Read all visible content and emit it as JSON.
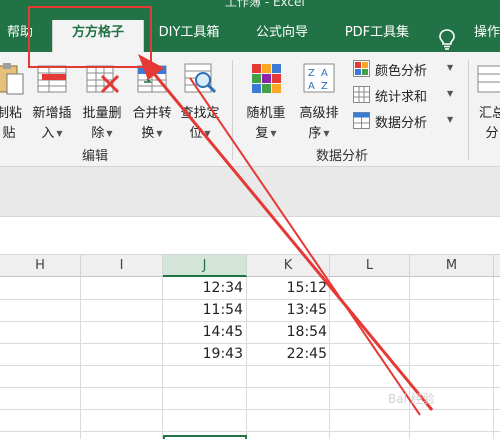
{
  "window": {
    "title_partial": "工作簿 - Excel"
  },
  "tabs": [
    {
      "label": "帮助"
    },
    {
      "label": "方方格子",
      "active": true
    },
    {
      "label": "DIY工具箱"
    },
    {
      "label": "公式向导"
    },
    {
      "label": "PDF工具集"
    },
    {
      "label": "操作"
    }
  ],
  "ribbon": {
    "edit_group": {
      "label": "编辑",
      "buttons": [
        {
          "line1": "制粘",
          "line2": "贴"
        },
        {
          "line1": "新增插",
          "line2": "入"
        },
        {
          "line1": "批量删",
          "line2": "除"
        },
        {
          "line1": "合并转",
          "line2": "换"
        },
        {
          "line1": "查找定",
          "line2": "位"
        }
      ]
    },
    "analysis_group": {
      "label": "数据分析",
      "buttons": [
        {
          "line1": "随机重",
          "line2": "复"
        },
        {
          "line1": "高级排",
          "line2": "序"
        }
      ],
      "small_buttons": [
        {
          "label": "颜色分析"
        },
        {
          "label": "统计求和"
        },
        {
          "label": "数据分析"
        }
      ]
    },
    "summary": {
      "line1": "汇总",
      "line2": "分"
    }
  },
  "sheet": {
    "columns": [
      "H",
      "I",
      "J",
      "K",
      "L",
      "M"
    ],
    "selected_column": "J",
    "rows": [
      {
        "J": "12:34",
        "K": "15:12"
      },
      {
        "J": "11:54",
        "K": "13:45"
      },
      {
        "J": "14:45",
        "K": "18:54"
      },
      {
        "J": "19:43",
        "K": "22:45"
      }
    ]
  },
  "watermark": "Bai 经验",
  "colors": {
    "accent": "#217346",
    "annotation": "#e53935"
  }
}
